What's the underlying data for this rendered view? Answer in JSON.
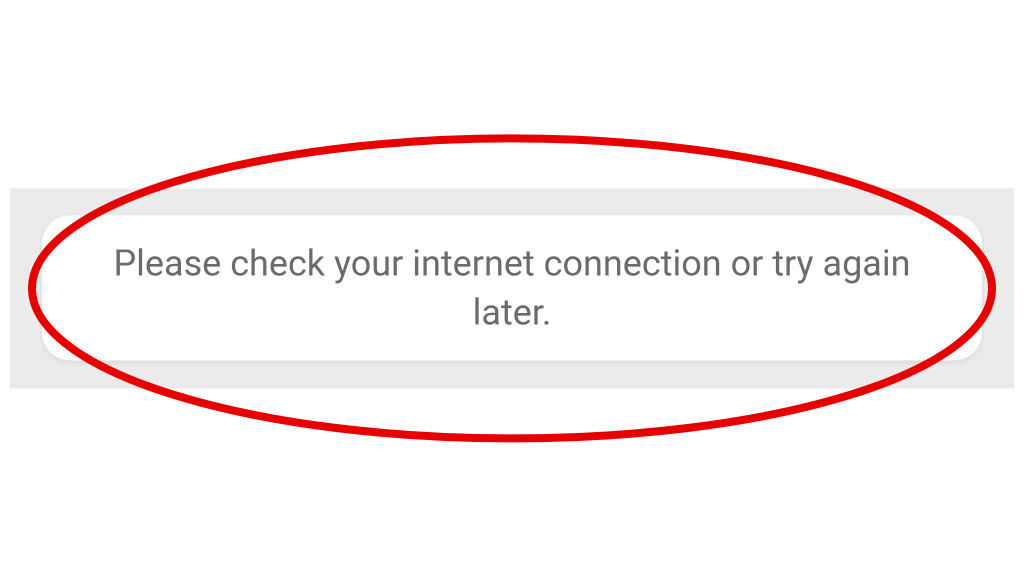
{
  "toast": {
    "message": "Please check your internet connection or try again later."
  },
  "annotation": {
    "color": "#e60000"
  }
}
